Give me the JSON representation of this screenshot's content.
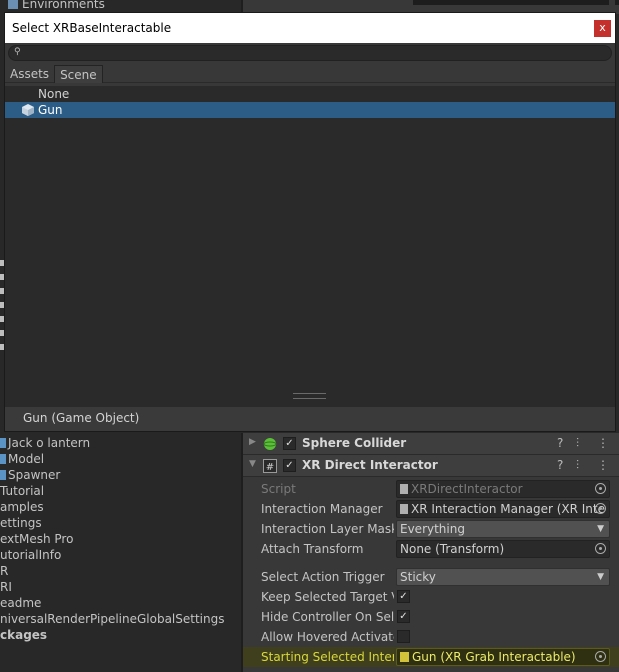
{
  "background": {
    "environments_label": "Environments"
  },
  "picker": {
    "title": "Select XRBaseInteractable",
    "close_label": "x",
    "search_placeholder": "",
    "tabs": [
      "Assets",
      "Scene"
    ],
    "active_tab": "Scene",
    "items": [
      {
        "label": "None",
        "selected": false
      },
      {
        "label": "Gun",
        "selected": true
      }
    ],
    "footer_selection": "Gun (Game Object)"
  },
  "hierarchy": {
    "items": [
      "Jack o lantern",
      "Model",
      "Spawner",
      "Tutorial",
      "amples",
      "ettings",
      "extMesh Pro",
      "utorialInfo",
      "R",
      "RI",
      "eadme",
      "niversalRenderPipelineGlobalSettings",
      "ckages"
    ]
  },
  "inspector": {
    "sphere_collider": {
      "name": "Sphere Collider",
      "enabled": true
    },
    "direct_interactor": {
      "name": "XR Direct Interactor",
      "enabled": true,
      "script_label": "Script",
      "script_value": "XRDirectInteractor",
      "interaction_manager_label": "Interaction Manager",
      "interaction_manager_value": "XR Interaction Manager (XR Inte",
      "layer_mask_label": "Interaction Layer Mask",
      "layer_mask_value": "Everything",
      "attach_transform_label": "Attach Transform",
      "attach_transform_value": "None (Transform)",
      "select_action_trigger_label": "Select Action Trigger",
      "select_action_trigger_value": "Sticky",
      "keep_selected_label": "Keep Selected Target V",
      "keep_selected_value": true,
      "hide_controller_label": "Hide Controller On Selec",
      "hide_controller_value": true,
      "allow_hovered_label": "Allow Hovered Activate",
      "allow_hovered_value": false,
      "starting_selected_label": "Starting Selected Intera",
      "starting_selected_value": "Gun (XR Grab Interactable)"
    },
    "check_glyph": "✓",
    "help_glyph": "?",
    "settings_glyph": "⫶",
    "menu_glyph": "⋮"
  },
  "colors": {
    "selection": "#2c5d87",
    "highlight": "#d8d83a",
    "close": "#c4302b"
  }
}
